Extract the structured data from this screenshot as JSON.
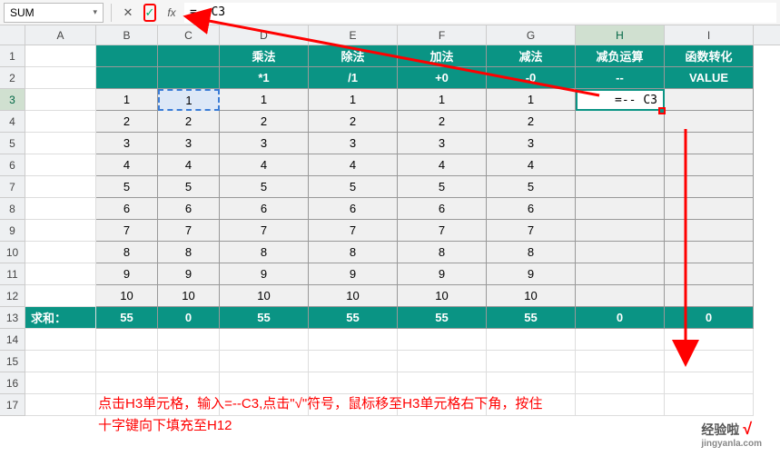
{
  "formula_bar": {
    "name_box": "SUM",
    "cancel": "✕",
    "confirm": "✓",
    "fx": "fx",
    "formula": "=--C3"
  },
  "columns": [
    "A",
    "B",
    "C",
    "D",
    "E",
    "F",
    "G",
    "H",
    "I"
  ],
  "row_numbers": [
    "1",
    "2",
    "3",
    "4",
    "5",
    "6",
    "7",
    "8",
    "9",
    "10",
    "11",
    "12",
    "13",
    "14",
    "15",
    "16",
    "17"
  ],
  "active_col": "H",
  "active_row": "3",
  "header1": {
    "B": "",
    "C": "",
    "D": "乘法",
    "E": "除法",
    "F": "加法",
    "G": "减法",
    "H": "减负运算",
    "I": "函数转化"
  },
  "header2": {
    "B": "",
    "C": "",
    "D": "*1",
    "E": "/1",
    "F": "+0",
    "G": "-0",
    "H": "--",
    "I": "VALUE"
  },
  "data_rows": [
    {
      "B": "1",
      "C": "1",
      "D": "1",
      "E": "1",
      "F": "1",
      "G": "1",
      "H": "=-- C3",
      "I": ""
    },
    {
      "B": "2",
      "C": "2",
      "D": "2",
      "E": "2",
      "F": "2",
      "G": "2",
      "H": "",
      "I": ""
    },
    {
      "B": "3",
      "C": "3",
      "D": "3",
      "E": "3",
      "F": "3",
      "G": "3",
      "H": "",
      "I": ""
    },
    {
      "B": "4",
      "C": "4",
      "D": "4",
      "E": "4",
      "F": "4",
      "G": "4",
      "H": "",
      "I": ""
    },
    {
      "B": "5",
      "C": "5",
      "D": "5",
      "E": "5",
      "F": "5",
      "G": "5",
      "H": "",
      "I": ""
    },
    {
      "B": "6",
      "C": "6",
      "D": "6",
      "E": "6",
      "F": "6",
      "G": "6",
      "H": "",
      "I": ""
    },
    {
      "B": "7",
      "C": "7",
      "D": "7",
      "E": "7",
      "F": "7",
      "G": "7",
      "H": "",
      "I": ""
    },
    {
      "B": "8",
      "C": "8",
      "D": "8",
      "E": "8",
      "F": "8",
      "G": "8",
      "H": "",
      "I": ""
    },
    {
      "B": "9",
      "C": "9",
      "D": "9",
      "E": "9",
      "F": "9",
      "G": "9",
      "H": "",
      "I": ""
    },
    {
      "B": "10",
      "C": "10",
      "D": "10",
      "E": "10",
      "F": "10",
      "G": "10",
      "H": "",
      "I": ""
    }
  ],
  "sum_row": {
    "A": "求和：",
    "B": "55",
    "C": "0",
    "D": "55",
    "E": "55",
    "F": "55",
    "G": "55",
    "H": "0",
    "I": "0"
  },
  "instruction_line1": "点击H3单元格，输入=--C3,点击\"√\"符号，鼠标移至H3单元格右下角，按住",
  "instruction_line2": "十字键向下填充至H12",
  "watermark": {
    "title": "经验啦",
    "check": "√",
    "sub": "jingyanla.com"
  }
}
